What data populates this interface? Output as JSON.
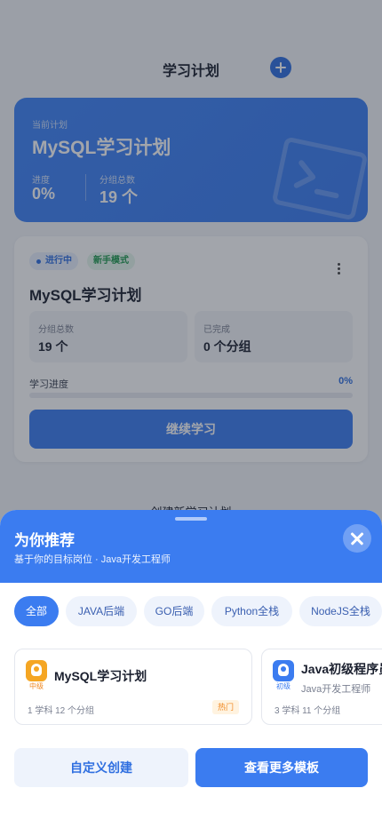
{
  "header": {
    "title": "学习计划",
    "add_icon": "plus-circle-icon"
  },
  "current_plan": {
    "label": "当前计划",
    "title": "MySQL学习计划",
    "progress_label": "进度",
    "progress_value": "0%",
    "groups_label": "分组总数",
    "groups_value": "19 个",
    "decor_icon": "terminal-icon"
  },
  "plan_card": {
    "status_tag": "进行中",
    "mode_tag": "新手模式",
    "title": "MySQL学习计划",
    "total_groups_label": "分组总数",
    "total_groups_value": "19 个",
    "completed_label": "已完成",
    "completed_value": "0 个分组",
    "progress_label": "学习进度",
    "progress_pct": "0%",
    "progress_fraction": 0,
    "continue_button": "继续学习"
  },
  "create_link": "创建新学习计划",
  "sheet": {
    "title": "为你推荐",
    "subtitle": "基于你的目标岗位 · Java开发工程师",
    "chips": [
      "全部",
      "JAVA后端",
      "GO后端",
      "Python全栈",
      "NodeJS全栈"
    ],
    "active_chip": 0,
    "cards": [
      {
        "title": "MySQL学习计划",
        "role": "",
        "level": "中级",
        "meta": "1 学科  12 个分组",
        "hot": "热门",
        "badge_color": "#f5a623"
      },
      {
        "title": "Java初级程序员",
        "role": "Java开发工程师",
        "level": "初级",
        "meta": "3 学科  11 个分组",
        "hot": "",
        "badge_color": "#3b7cf0"
      }
    ],
    "custom_button": "自定义创建",
    "more_button": "查看更多模板"
  },
  "colors": {
    "primary": "#3b7cf0",
    "hot": "#f08a24",
    "mode_green": "#1e9a4e"
  }
}
